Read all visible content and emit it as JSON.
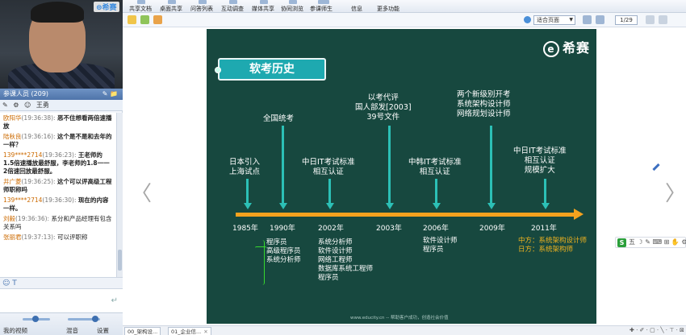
{
  "video": {
    "brand": "⊜希赛"
  },
  "members": {
    "header": "参课人员 (209)",
    "tools": "✎ 📁",
    "row_user": "王勇",
    "row_icons": [
      "✎",
      "⚙",
      "☺"
    ]
  },
  "chat": {
    "messages": [
      {
        "who": "欧阳华",
        "time": "(19:36:38):",
        "text": "恶不住想看两倍速播放",
        "bold": true
      },
      {
        "who": "陆秋良",
        "time": "(19:36:16):",
        "text": "这个是不是和去年的一样？",
        "bold": true
      },
      {
        "who": "139****2714",
        "time": "(19:36:23):",
        "text": "王老师的1.5倍速播放最舒服，李老师的1.8一一2倍速回放最舒服。",
        "bold": true
      },
      {
        "who": "井广菱",
        "time": "(19:36:25):",
        "text": "这个可以评高级工程师职称吗",
        "bold": true
      },
      {
        "who": "139****2714",
        "time": "(19:36:30):",
        "text": "现在的内容一样。",
        "bold": true
      },
      {
        "who": "刘毅",
        "time": "(19:36:36):",
        "text": "系分和产品经理有包含关系吗",
        "bold": false
      },
      {
        "who": "张丽君",
        "time": "(19:37:13):",
        "text": "可以评职称",
        "bold": false
      }
    ],
    "tools_icons": "☺ T",
    "send_icon": "↵"
  },
  "bottom": {
    "video_label": "我的视频",
    "audio_label": "混音",
    "settings_label": "设置"
  },
  "toolbar": {
    "items": [
      "共享文档",
      "桌面共享",
      "问答列表",
      "互动调查",
      "媒体共享",
      "协同浏览",
      "参课师生",
      "信息",
      "更多功能"
    ]
  },
  "toolbar2": {
    "zoom": "适合页面",
    "page": "1/29"
  },
  "slide": {
    "logo": "希赛",
    "logo_mark": "e",
    "title": "软考历史",
    "events": [
      {
        "lines": [
          "日本引入",
          "上海试点"
        ]
      },
      {
        "lines": [
          "全国统考"
        ]
      },
      {
        "lines": [
          "中日IT考试标准",
          "相互认证"
        ]
      },
      {
        "lines": [
          "以考代评",
          "国人部发[2003]",
          "39号文件"
        ]
      },
      {
        "lines": [
          "中韩IT考试标准",
          "相互认证"
        ]
      },
      {
        "lines": [
          "两个新级别开考",
          "系统架构设计师",
          "网络规划设计师"
        ]
      },
      {
        "lines": [
          "中日IT考试标准",
          "相互认证",
          "规模扩大"
        ]
      }
    ],
    "years": [
      "1985年",
      "1990年",
      "2002年",
      "2003年",
      "2006年",
      "2009年",
      "2011年"
    ],
    "roles_1990": [
      "程序员",
      "高级程序员",
      "系统分析师"
    ],
    "roles_2002": [
      "系统分析师",
      "软件设计师",
      "网络工程师",
      "数据库系统工程师",
      "程序员"
    ],
    "roles_2006": [
      "软件设计师",
      "程序员"
    ],
    "roles_2011": [
      "中方：系统架构设计师",
      "日方：系统架构师"
    ],
    "footer": "www.educity.cn  -- 帮助客户成功，创造社会价值",
    "colors": {
      "background": "#17483f",
      "accent": "#1ea9b0",
      "timeline": "#f4a21e",
      "highlight": "#f2b41f"
    }
  },
  "float_tools": {
    "text": "五 ☽ ✎ ⌨ ⊞ ✋ ⚙"
  },
  "tabs": [
    {
      "label": "00_架构设..."
    },
    {
      "label": "01_企业信..."
    }
  ],
  "bottom_tools": "✚ · ✐ · ▢ · ╲ · ⊤ · ⊠"
}
